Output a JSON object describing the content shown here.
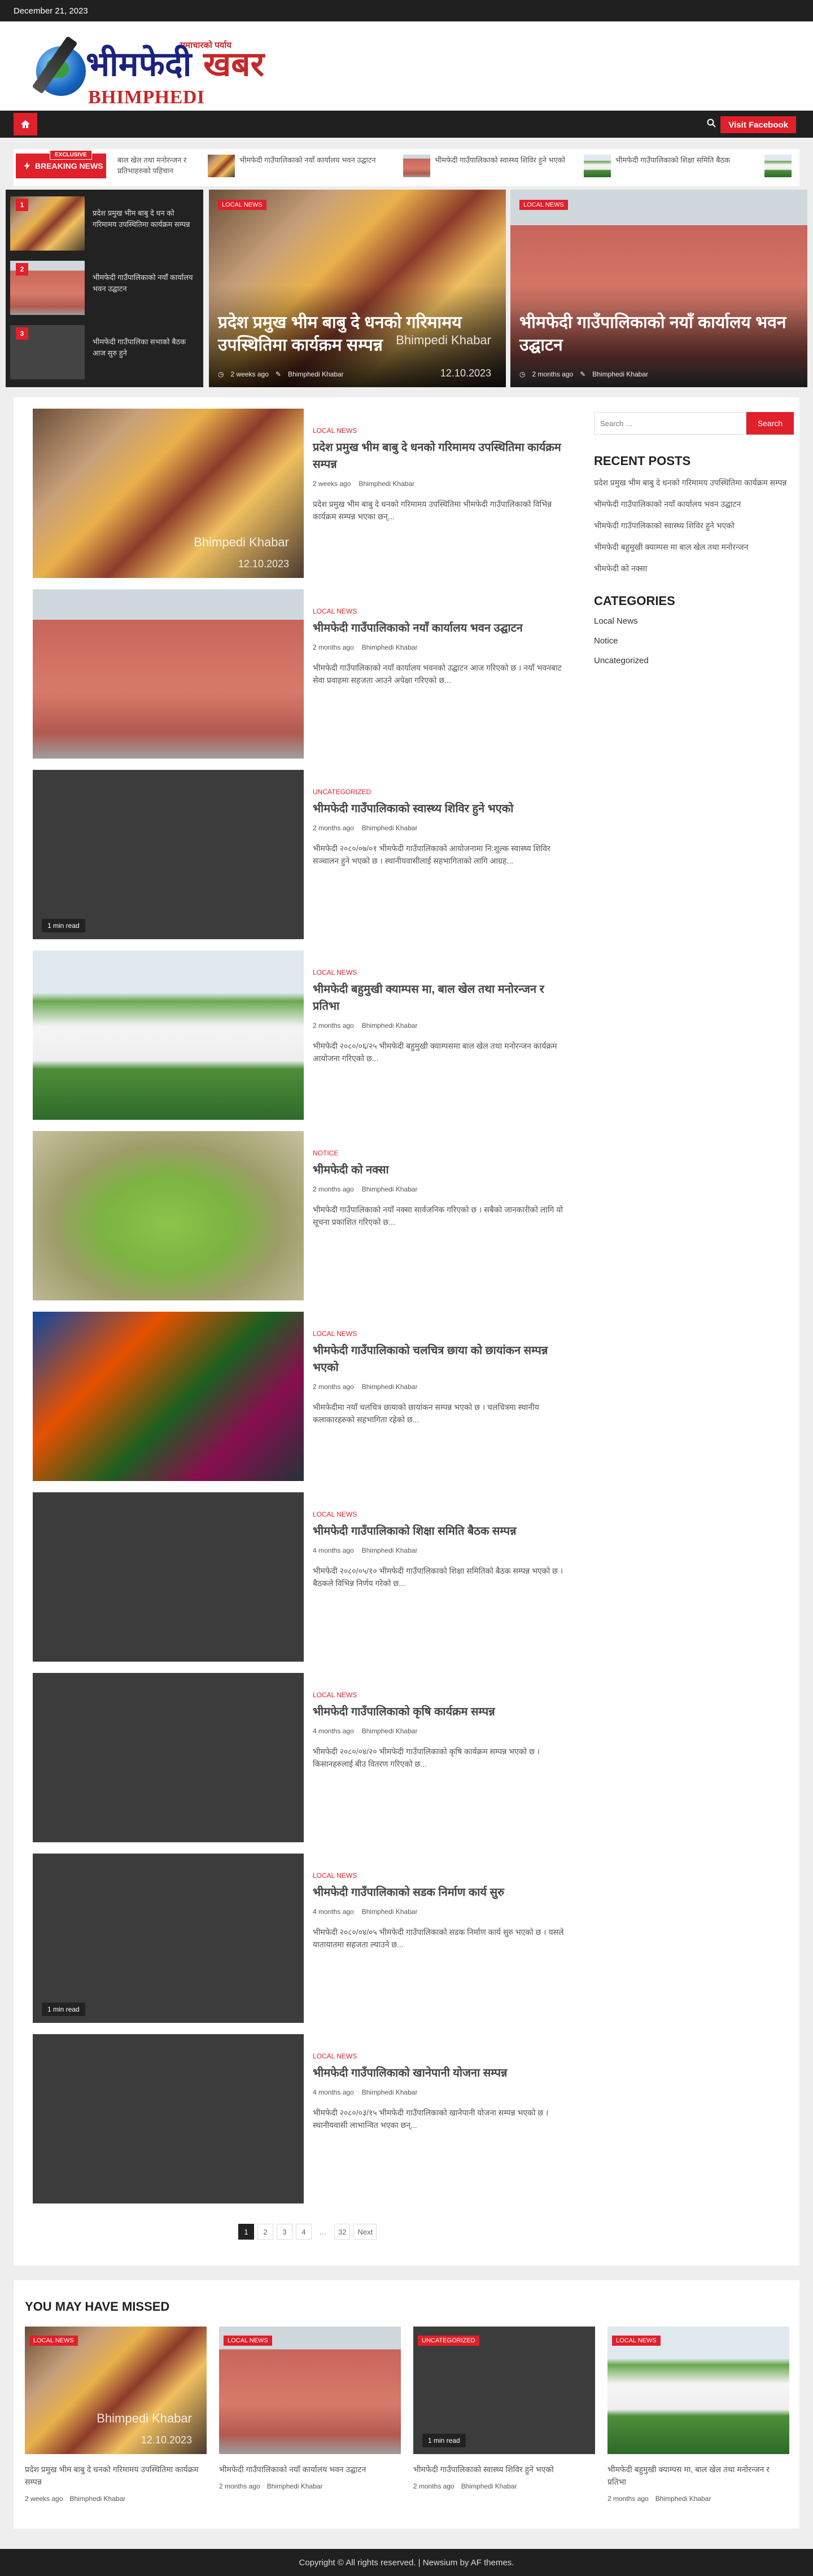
{
  "topbar": {
    "date": "December 21, 2023"
  },
  "logo": {
    "tagline": "समाचारको पर्याय",
    "name_a": "भीमफेदी",
    "name_b": "खबर",
    "english": "BHIMPHEDI KHABAR"
  },
  "nav": {
    "facebook_label": "Visit Facebook"
  },
  "ticker": {
    "exclusive_label": "EXCLUSIVE",
    "breaking_label": "BREAKING NEWS",
    "items": [
      "बाल खेल तथा मनोरन्जन र प्रतिभाहरुको पहिचान",
      "भीमफेदी गाउँपालिकाको नयाँ कार्यालय भवन उद्घाटन",
      "भीमफेदी गाउँपालिकाको स्वास्थ्य शिविर हुने भएको",
      "भीमफेदी गाउँपालिकाको शिक्षा समिति बैठक"
    ]
  },
  "hero": {
    "list": [
      {
        "num": "1",
        "title": "प्रदेश प्रमुख भीम बाबु दे धन को गरिमामय उपस्थितिमा कार्यक्रम सम्पन्न"
      },
      {
        "num": "2",
        "title": "भीमफेदी गाउँपालिकाको नयाँ कार्यालय भवन उद्घाटन"
      },
      {
        "num": "3",
        "title": "भीमफेदी गाउँपालिका सभाको बैठक आज सुरु हुने"
      }
    ],
    "center": {
      "category": "Local News",
      "title": "प्रदेश प्रमुख भीम बाबु दे धनको गरिमामय उपस्थितिमा कार्यक्रम सम्पन्न",
      "date": "2 weeks ago",
      "author": "Bhimphedi Khabar"
    },
    "right": {
      "category": "Local News",
      "title": "भीमफेदी गाउँपालिकाको नयाँ कार्यालय भवन उद्घाटन",
      "date": "2 months ago",
      "author": "Bhimphedi Khabar"
    }
  },
  "watermark": {
    "name": "Bhimpedi Khabar",
    "temp": "°C",
    "date": "12.10.2023"
  },
  "posts": [
    {
      "category": "Local News",
      "title": "प्रदेश प्रमुख भीम बाबु दे धनको गरिमामय उपस्थितिमा कार्यक्रम सम्पन्न",
      "date": "2 weeks ago",
      "author": "Bhimphedi Khabar",
      "excerpt": "प्रदेश प्रमुख भीम बाबु दे धनको गरिमामय उपस्थितिमा भीमफेदी गाउँपालिकाको विभिन्न कार्यक्रम सम्पन्न भएका छन्...",
      "readtime": ""
    },
    {
      "category": "Local News",
      "title": "भीमफेदी गाउँपालिकाको नयाँ कार्यालय भवन उद्घाटन",
      "date": "2 months ago",
      "author": "Bhimphedi Khabar",
      "excerpt": "भीमफेदी गाउँपालिकाको नयाँ कार्यालय भवनको उद्घाटन आज गरिएको छ । नयाँ भवनबाट सेवा प्रवाहमा सहजता आउने अपेक्षा गरिएको छ...",
      "readtime": ""
    },
    {
      "category": "Uncategorized",
      "title": "भीमफेदी गाउँपालिकाको स्वास्थ्य शिविर हुने भएको",
      "date": "2 months ago",
      "author": "Bhimphedi Khabar",
      "excerpt": "भीमफेदी २०८०/०७/०१ भीमफेदी गाउँपालिकाको आयोजनामा नि:शुल्क स्वास्थ्य शिविर सञ्चालन हुने भएको छ । स्थानीयवासीलाई सहभागिताको लागि आग्रह...",
      "readtime": "1 min read"
    },
    {
      "category": "Local News",
      "title": "भीमफेदी बहुमुखी क्याम्पस मा, बाल खेल तथा मनोरन्जन र प्रतिभा",
      "date": "2 months ago",
      "author": "Bhimphedi Khabar",
      "excerpt": "भीमफेदी २०८०/०६/२५ भीमफेदी बहुमुखी क्याम्पसमा बाल खेल तथा मनोरन्जन कार्यक्रम आयोजना गरिएको छ...",
      "readtime": ""
    },
    {
      "category": "Notice",
      "title": "भीमफेदी को नक्सा",
      "date": "2 months ago",
      "author": "Bhimphedi Khabar",
      "excerpt": "भीमफेदी गाउँपालिकाको नयाँ नक्सा सार्वजनिक गरिएको छ । सबैको जानकारीको लागि यो सूचना प्रकाशित गरिएको छ...",
      "readtime": ""
    },
    {
      "category": "Local News",
      "title": "भीमफेदी गाउँपालिकाको चलचित्र छाया को छायांकन सम्पन्न भएको",
      "date": "2 months ago",
      "author": "Bhimphedi Khabar",
      "excerpt": "भीमफेदीमा नयाँ चलचित्र छायाको छायांकन सम्पन्न भएको छ । चलचित्रमा स्थानीय कलाकारहरुको सहभागिता रहेको छ...",
      "readtime": ""
    },
    {
      "category": "Local News",
      "title": "भीमफेदी गाउँपालिकाको शिक्षा समिति बैठक सम्पन्न",
      "date": "4 months ago",
      "author": "Bhimphedi Khabar",
      "excerpt": "भीमफेदी २०८०/०५/१० भीमफेदी गाउँपालिकाको शिक्षा समितिको बैठक सम्पन्न भएको छ । बैठकले विभिन्न निर्णय गरेको छ...",
      "readtime": ""
    },
    {
      "category": "Local News",
      "title": "भीमफेदी गाउँपालिकाको कृषि कार्यक्रम सम्पन्न",
      "date": "4 months ago",
      "author": "Bhimphedi Khabar",
      "excerpt": "भीमफेदी २०८०/०४/२० भीमफेदी गाउँपालिकाको कृषि कार्यक्रम सम्पन्न भएको छ । किसानहरुलाई बीउ वितरण गरिएको छ...",
      "readtime": ""
    },
    {
      "category": "Local News",
      "title": "भीमफेदी गाउँपालिकाको सडक निर्माण कार्य सुरु",
      "date": "4 months ago",
      "author": "Bhimphedi Khabar",
      "excerpt": "भीमफेदी २०८०/०४/०५ भीमफेदी गाउँपालिकाको सडक निर्माण कार्य सुरु भएको छ । यसले यातायातमा सहजता ल्याउने छ...",
      "readtime": "1 min read"
    },
    {
      "category": "Local News",
      "title": "भीमफेदी गाउँपालिकाको खानेपानी योजना सम्पन्न",
      "date": "4 months ago",
      "author": "Bhimphedi Khabar",
      "excerpt": "भीमफेदी २०८०/०३/१५ भीमफेदी गाउँपालिकाको खानेपानी योजना सम्पन्न भएको छ । स्थानीयवासी लाभान्वित भएका छन्...",
      "readtime": ""
    }
  ],
  "sidebar": {
    "search_placeholder": "Search …",
    "search_button": "Search",
    "recent_heading": "RECENT POSTS",
    "recent": [
      "प्रदेश प्रमुख भीम बाबु दे धनको गरिमामय उपस्थितिमा कार्यक्रम सम्पन्न",
      "भीमफेदी गाउँपालिकाको नयाँ कार्यालय भवन उद्घाटन",
      "भीमफेदी गाउँपालिकाको स्वास्थ्य शिविर हुने भएको",
      "भीमफेदी बहुमुखी क्याम्पस मा बाल खेल तथा मनोरन्जन",
      "भीमफेदी को नक्सा"
    ],
    "categories_heading": "CATEGORIES",
    "categories": [
      "Local News",
      "Notice",
      "Uncategorized"
    ]
  },
  "pagination": [
    "1",
    "2",
    "3",
    "4",
    "…",
    "32",
    "Next"
  ],
  "missed": {
    "heading": "YOU MAY HAVE MISSED",
    "cards": [
      {
        "category": "Local News",
        "title": "प्रदेश प्रमुख भीम बाबु दे धनको गरिमामय उपस्थितिमा कार्यक्रम सम्पन्न",
        "date": "2 weeks ago",
        "author": "Bhimphedi Khabar",
        "readtime": ""
      },
      {
        "category": "Local News",
        "title": "भीमफेदी गाउँपालिकाको नयाँ कार्यालय भवन उद्घाटन",
        "date": "2 months ago",
        "author": "Bhimphedi Khabar",
        "readtime": ""
      },
      {
        "category": "Uncategorized",
        "title": "भीमफेदी गाउँपालिकाको स्वास्थ्य शिविर हुने भएको",
        "date": "2 months ago",
        "author": "Bhimphedi Khabar",
        "readtime": "1 min read"
      },
      {
        "category": "Local News",
        "title": "भीमफेदी बहुमुखी क्याम्पस मा, बाल खेल तथा मनोरन्जन र प्रतिभा",
        "date": "2 months ago",
        "author": "Bhimphedi Khabar",
        "readtime": ""
      }
    ]
  },
  "footer": {
    "text": "Copyright © All rights reserved. | Newsium by AF themes."
  },
  "colors": {
    "accent": "#e0202a",
    "dark": "#202020"
  }
}
